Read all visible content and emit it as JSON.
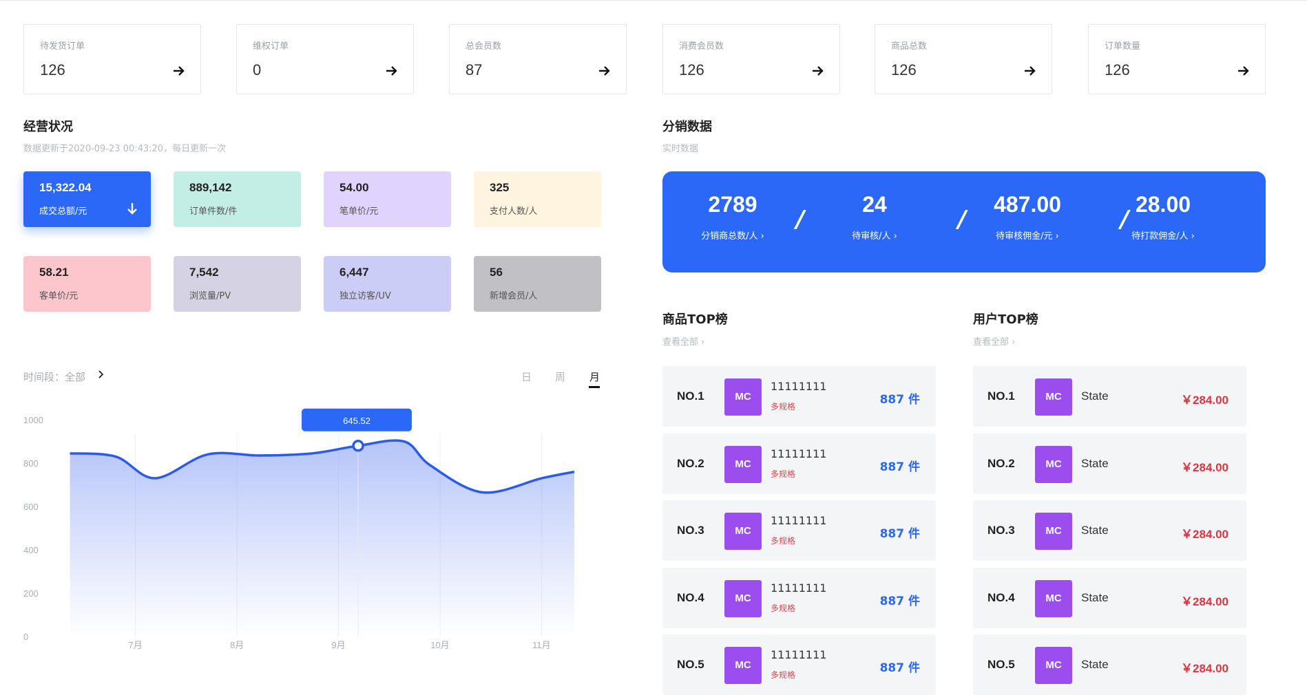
{
  "stats": [
    {
      "label": "待发货订单",
      "value": "126"
    },
    {
      "label": "维权订单",
      "value": "0"
    },
    {
      "label": "总会员数",
      "value": "87"
    },
    {
      "label": "消费会员数",
      "value": "126"
    },
    {
      "label": "商品总数",
      "value": "126"
    },
    {
      "label": "订单数量",
      "value": "126"
    }
  ],
  "business": {
    "title": "经营状况",
    "updated": "数据更新于2020-09-23 00:43:20，每日更新一次",
    "tiles": [
      {
        "value": "15,322.04",
        "label": "成交总额/元",
        "color": "#2c68f8"
      },
      {
        "value": "889,142",
        "label": "订单件数/件",
        "color": "#c3eee5"
      },
      {
        "value": "54.00",
        "label": "笔单价/元",
        "color": "#e0d3fd"
      },
      {
        "value": "325",
        "label": "支付人数/人",
        "color": "#fef4df"
      },
      {
        "value": "58.21",
        "label": "客单价/元",
        "color": "#fdc6cc"
      },
      {
        "value": "7,542",
        "label": "浏览量/PV",
        "color": "#d5d3e3"
      },
      {
        "value": "6,447",
        "label": "独立访客/UV",
        "color": "#cbcdf6"
      },
      {
        "value": "56",
        "label": "新增会员/人",
        "color": "#c0c0c5"
      }
    ]
  },
  "chart_controls": {
    "period_label": "时间段：全部",
    "tabs": [
      "日",
      "周",
      "月"
    ],
    "active_tab": "月"
  },
  "chart_data": {
    "type": "area",
    "x_ticks": [
      "7月",
      "8月",
      "9月",
      "10月",
      "11月"
    ],
    "ylim": [
      0,
      1000
    ],
    "y_ticks": [
      0,
      200,
      400,
      600,
      800,
      1000
    ],
    "grid": "vertical",
    "series": [
      {
        "x": [
          0.3,
          1.0,
          1.6,
          2.4,
          3.2,
          4.0,
          4.7,
          5.4,
          5.8,
          6.6,
          7.5,
          8.0
        ],
        "values": [
          845,
          830,
          730,
          840,
          835,
          845,
          880,
          900,
          790,
          665,
          730,
          760
        ]
      }
    ],
    "tooltip": {
      "x": 4.7,
      "value": "645.52",
      "label": "645.52"
    },
    "line_color": "#2c5ae9",
    "fill_color": "#5b7ef2"
  },
  "distribution": {
    "title": "分销数据",
    "subtitle": "实时数据",
    "items": [
      {
        "value": "2789",
        "label": "分销商总数/人 ›"
      },
      {
        "value": "24",
        "label": "待审核/人 ›"
      },
      {
        "value": "487.00",
        "label": "待审核佣金/元 ›"
      },
      {
        "value": "28.00",
        "label": "待打款佣金/人 ›"
      }
    ],
    "separator": "/"
  },
  "product_top": {
    "title": "商品TOP榜",
    "view_all": "查看全部 ›",
    "rows": [
      {
        "rank": "NO.1",
        "thumb": "MC",
        "name": "11111111",
        "tag": "多规格",
        "count": "887 件"
      },
      {
        "rank": "NO.2",
        "thumb": "MC",
        "name": "11111111",
        "tag": "多规格",
        "count": "887 件"
      },
      {
        "rank": "NO.3",
        "thumb": "MC",
        "name": "11111111",
        "tag": "多规格",
        "count": "887 件"
      },
      {
        "rank": "NO.4",
        "thumb": "MC",
        "name": "11111111",
        "tag": "多规格",
        "count": "887 件"
      },
      {
        "rank": "NO.5",
        "thumb": "MC",
        "name": "11111111",
        "tag": "多规格",
        "count": "887 件"
      }
    ]
  },
  "user_top": {
    "title": "用户TOP榜",
    "view_all": "查看全部 ›",
    "rows": [
      {
        "rank": "NO.1",
        "thumb": "MC",
        "name": "State",
        "amount": "￥284.00"
      },
      {
        "rank": "NO.2",
        "thumb": "MC",
        "name": "State",
        "amount": "￥284.00"
      },
      {
        "rank": "NO.3",
        "thumb": "MC",
        "name": "State",
        "amount": "￥284.00"
      },
      {
        "rank": "NO.4",
        "thumb": "MC",
        "name": "State",
        "amount": "￥284.00"
      },
      {
        "rank": "NO.5",
        "thumb": "MC",
        "name": "State",
        "amount": "￥284.00"
      }
    ]
  },
  "icons": {
    "stat_arrow": "arrow-right-icon",
    "tile_arrow": "arrow-down-icon",
    "period_chevron": "chevron-right-icon",
    "thumb": "product-thumbnail"
  }
}
